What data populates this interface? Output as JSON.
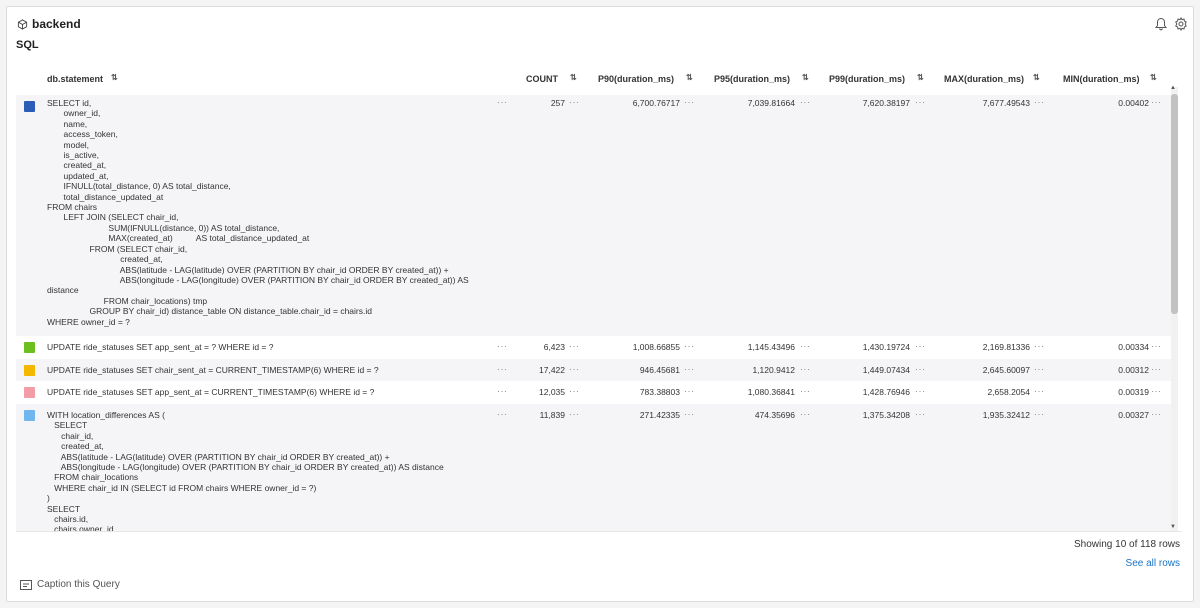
{
  "header": {
    "dataset_name": "backend",
    "section": "SQL",
    "icons": [
      "cube-icon",
      "bell-icon",
      "gear-icon"
    ]
  },
  "table": {
    "columns": [
      "db.statement",
      "COUNT",
      "P90(duration_ms)",
      "P95(duration_ms)",
      "P99(duration_ms)",
      "MAX(duration_ms)",
      "MIN(duration_ms)"
    ],
    "rows": [
      {
        "color": "#2a5cb8",
        "statement": "SELECT id,\n       owner_id,\n       name,\n       access_token,\n       model,\n       is_active,\n       created_at,\n       updated_at,\n       IFNULL(total_distance, 0) AS total_distance,\n       total_distance_updated_at\nFROM chairs\n       LEFT JOIN (SELECT chair_id,\n                          SUM(IFNULL(distance, 0)) AS total_distance,\n                          MAX(created_at)          AS total_distance_updated_at\n                  FROM (SELECT chair_id,\n                               created_at,\n                               ABS(latitude - LAG(latitude) OVER (PARTITION BY chair_id ORDER BY created_at)) +\n                               ABS(longitude - LAG(longitude) OVER (PARTITION BY chair_id ORDER BY created_at)) AS\ndistance\n                        FROM chair_locations) tmp\n                  GROUP BY chair_id) distance_table ON distance_table.chair_id = chairs.id\nWHERE owner_id = ?",
        "count": "257",
        "p90": "6,700.76717",
        "p95": "7,039.81664",
        "p99": "7,620.38197",
        "max": "7,677.49543",
        "min": "0.00402"
      },
      {
        "color": "#6cbf1f",
        "statement": "UPDATE ride_statuses SET app_sent_at = ? WHERE id = ?",
        "count": "6,423",
        "p90": "1,008.66855",
        "p95": "1,145.43496",
        "p99": "1,430.19724",
        "max": "2,169.81336",
        "min": "0.00334"
      },
      {
        "color": "#f5b800",
        "statement": "UPDATE ride_statuses SET chair_sent_at = CURRENT_TIMESTAMP(6) WHERE id = ?",
        "count": "17,422",
        "p90": "946.45681",
        "p95": "1,120.9412",
        "p99": "1,449.07434",
        "max": "2,645.60097",
        "min": "0.00312"
      },
      {
        "color": "#f29ca5",
        "statement": "UPDATE ride_statuses SET app_sent_at = CURRENT_TIMESTAMP(6) WHERE id = ?",
        "count": "12,035",
        "p90": "783.38803",
        "p95": "1,080.36841",
        "p99": "1,428.76946",
        "max": "2,658.2054",
        "min": "0.00319"
      },
      {
        "color": "#6fb7ee",
        "statement": "WITH location_differences AS (\n   SELECT\n      chair_id,\n      created_at,\n      ABS(latitude - LAG(latitude) OVER (PARTITION BY chair_id ORDER BY created_at)) +\n      ABS(longitude - LAG(longitude) OVER (PARTITION BY chair_id ORDER BY created_at)) AS distance\n   FROM chair_locations\n   WHERE chair_id IN (SELECT id FROM chairs WHERE owner_id = ?)\n)\nSELECT\n   chairs.id,\n   chairs.owner_id,",
        "count": "11,839",
        "p90": "271.42335",
        "p95": "474.35696",
        "p99": "1,375.34208",
        "max": "1,935.32412",
        "min": "0.00327"
      }
    ]
  },
  "footer": {
    "showing": "Showing 10 of 118 rows",
    "see_all": "See all rows",
    "caption": "Caption this Query"
  }
}
